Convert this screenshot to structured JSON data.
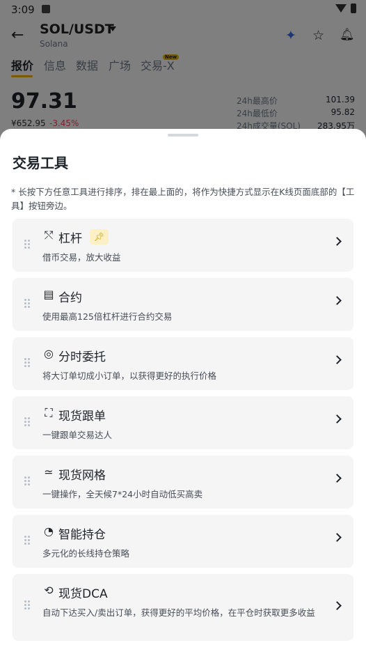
{
  "status_bar": {
    "time": "3:09"
  },
  "header": {
    "pair": "SOL/USDT",
    "coin_name": "Solana"
  },
  "tabs": [
    {
      "label": "报价"
    },
    {
      "label": "信息"
    },
    {
      "label": "数据"
    },
    {
      "label": "广场"
    },
    {
      "label": "交易-X"
    }
  ],
  "new_badge": "New",
  "ticker": {
    "price": "97.31",
    "fiat": "¥652.95",
    "change": "-3.45%",
    "stats": [
      {
        "label": "24h最高价",
        "value": "101.39"
      },
      {
        "label": "24h最低价",
        "value": "95.82"
      },
      {
        "label": "24h成交量(SOL)",
        "value": "283.95万"
      }
    ]
  },
  "sheet": {
    "title": "交易工具",
    "hint": "* 长按下方任意工具进行排序，排在最上面的，将作为快捷方式显示在K线页面底部的【工具】按钮旁边。",
    "tools": [
      {
        "name": "杠杆",
        "desc": "借币交易，放大收益",
        "icon": "leverage-icon"
      },
      {
        "name": "合约",
        "desc": "使用最高125倍杠杆进行合约交易",
        "icon": "futures-icon"
      },
      {
        "name": "分时委托",
        "desc": "将大订单切成小订单，以获得更好的执行价格",
        "icon": "twap-icon"
      },
      {
        "name": "现货跟单",
        "desc": "一键跟单交易达人",
        "icon": "copy-trading-icon"
      },
      {
        "name": "现货网格",
        "desc": "一键操作，全天候7*24小时自动低买高卖",
        "icon": "grid-icon"
      },
      {
        "name": "智能持仓",
        "desc": "多元化的长线持仓策略",
        "icon": "pie-icon"
      },
      {
        "name": "现货DCA",
        "desc": "自动下达买入/卖出订单，获得更好的平均价格，在平仓时获取更多收益",
        "icon": "dca-icon"
      }
    ]
  }
}
